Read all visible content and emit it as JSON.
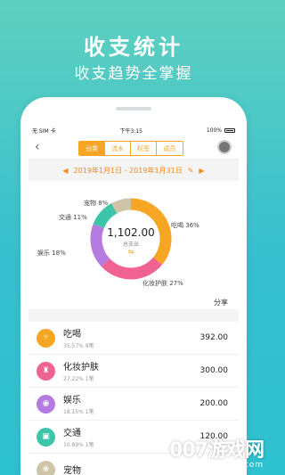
{
  "promo": {
    "headline": "收支统计",
    "subline": "收支趋势全掌握"
  },
  "status": {
    "carrier": "无 SIM 卡",
    "time": "下午3:15",
    "battery": "100%"
  },
  "nav": {
    "tabs": [
      "分类",
      "流水",
      "标签",
      "成员"
    ],
    "active_tab": "分类"
  },
  "date_range": "2019年1月1日 - 2019年1月31日",
  "chart_data": {
    "type": "pie",
    "center_value": "1,102.00",
    "center_label": "总支出",
    "categories": [
      "吃喝",
      "化妆护肤",
      "娱乐",
      "交通",
      "宠物"
    ],
    "values": [
      36,
      27,
      18,
      11,
      8
    ],
    "labels": [
      "吃喝 36%",
      "化妆护肤 27%",
      "娱乐 18%",
      "交通 11%",
      "宠物 8%"
    ],
    "colors": [
      "#f6a623",
      "#f06292",
      "#b57be0",
      "#3cc5a8",
      "#cfc4a8"
    ]
  },
  "share_label": "分享",
  "records": [
    {
      "name": "吃喝",
      "meta": "35.57%  9笔",
      "amount": "392.00",
      "color": "#f6a623",
      "icon": "fork-knife-icon"
    },
    {
      "name": "化妆护肤",
      "meta": "27.22%  1笔",
      "amount": "300.00",
      "color": "#f06292",
      "icon": "lipstick-icon"
    },
    {
      "name": "娱乐",
      "meta": "18.15%  1笔",
      "amount": "200.00",
      "color": "#b57be0",
      "icon": "gamepad-icon"
    },
    {
      "name": "交通",
      "meta": "10.89%  1笔",
      "amount": "120.00",
      "color": "#3cc5a8",
      "icon": "bus-icon"
    },
    {
      "name": "宠物",
      "meta": "",
      "amount": "",
      "color": "#cfc4a8",
      "icon": "paw-icon"
    }
  ],
  "watermark": {
    "line1": "007游戏网",
    "line2": "www.yx007.com"
  }
}
